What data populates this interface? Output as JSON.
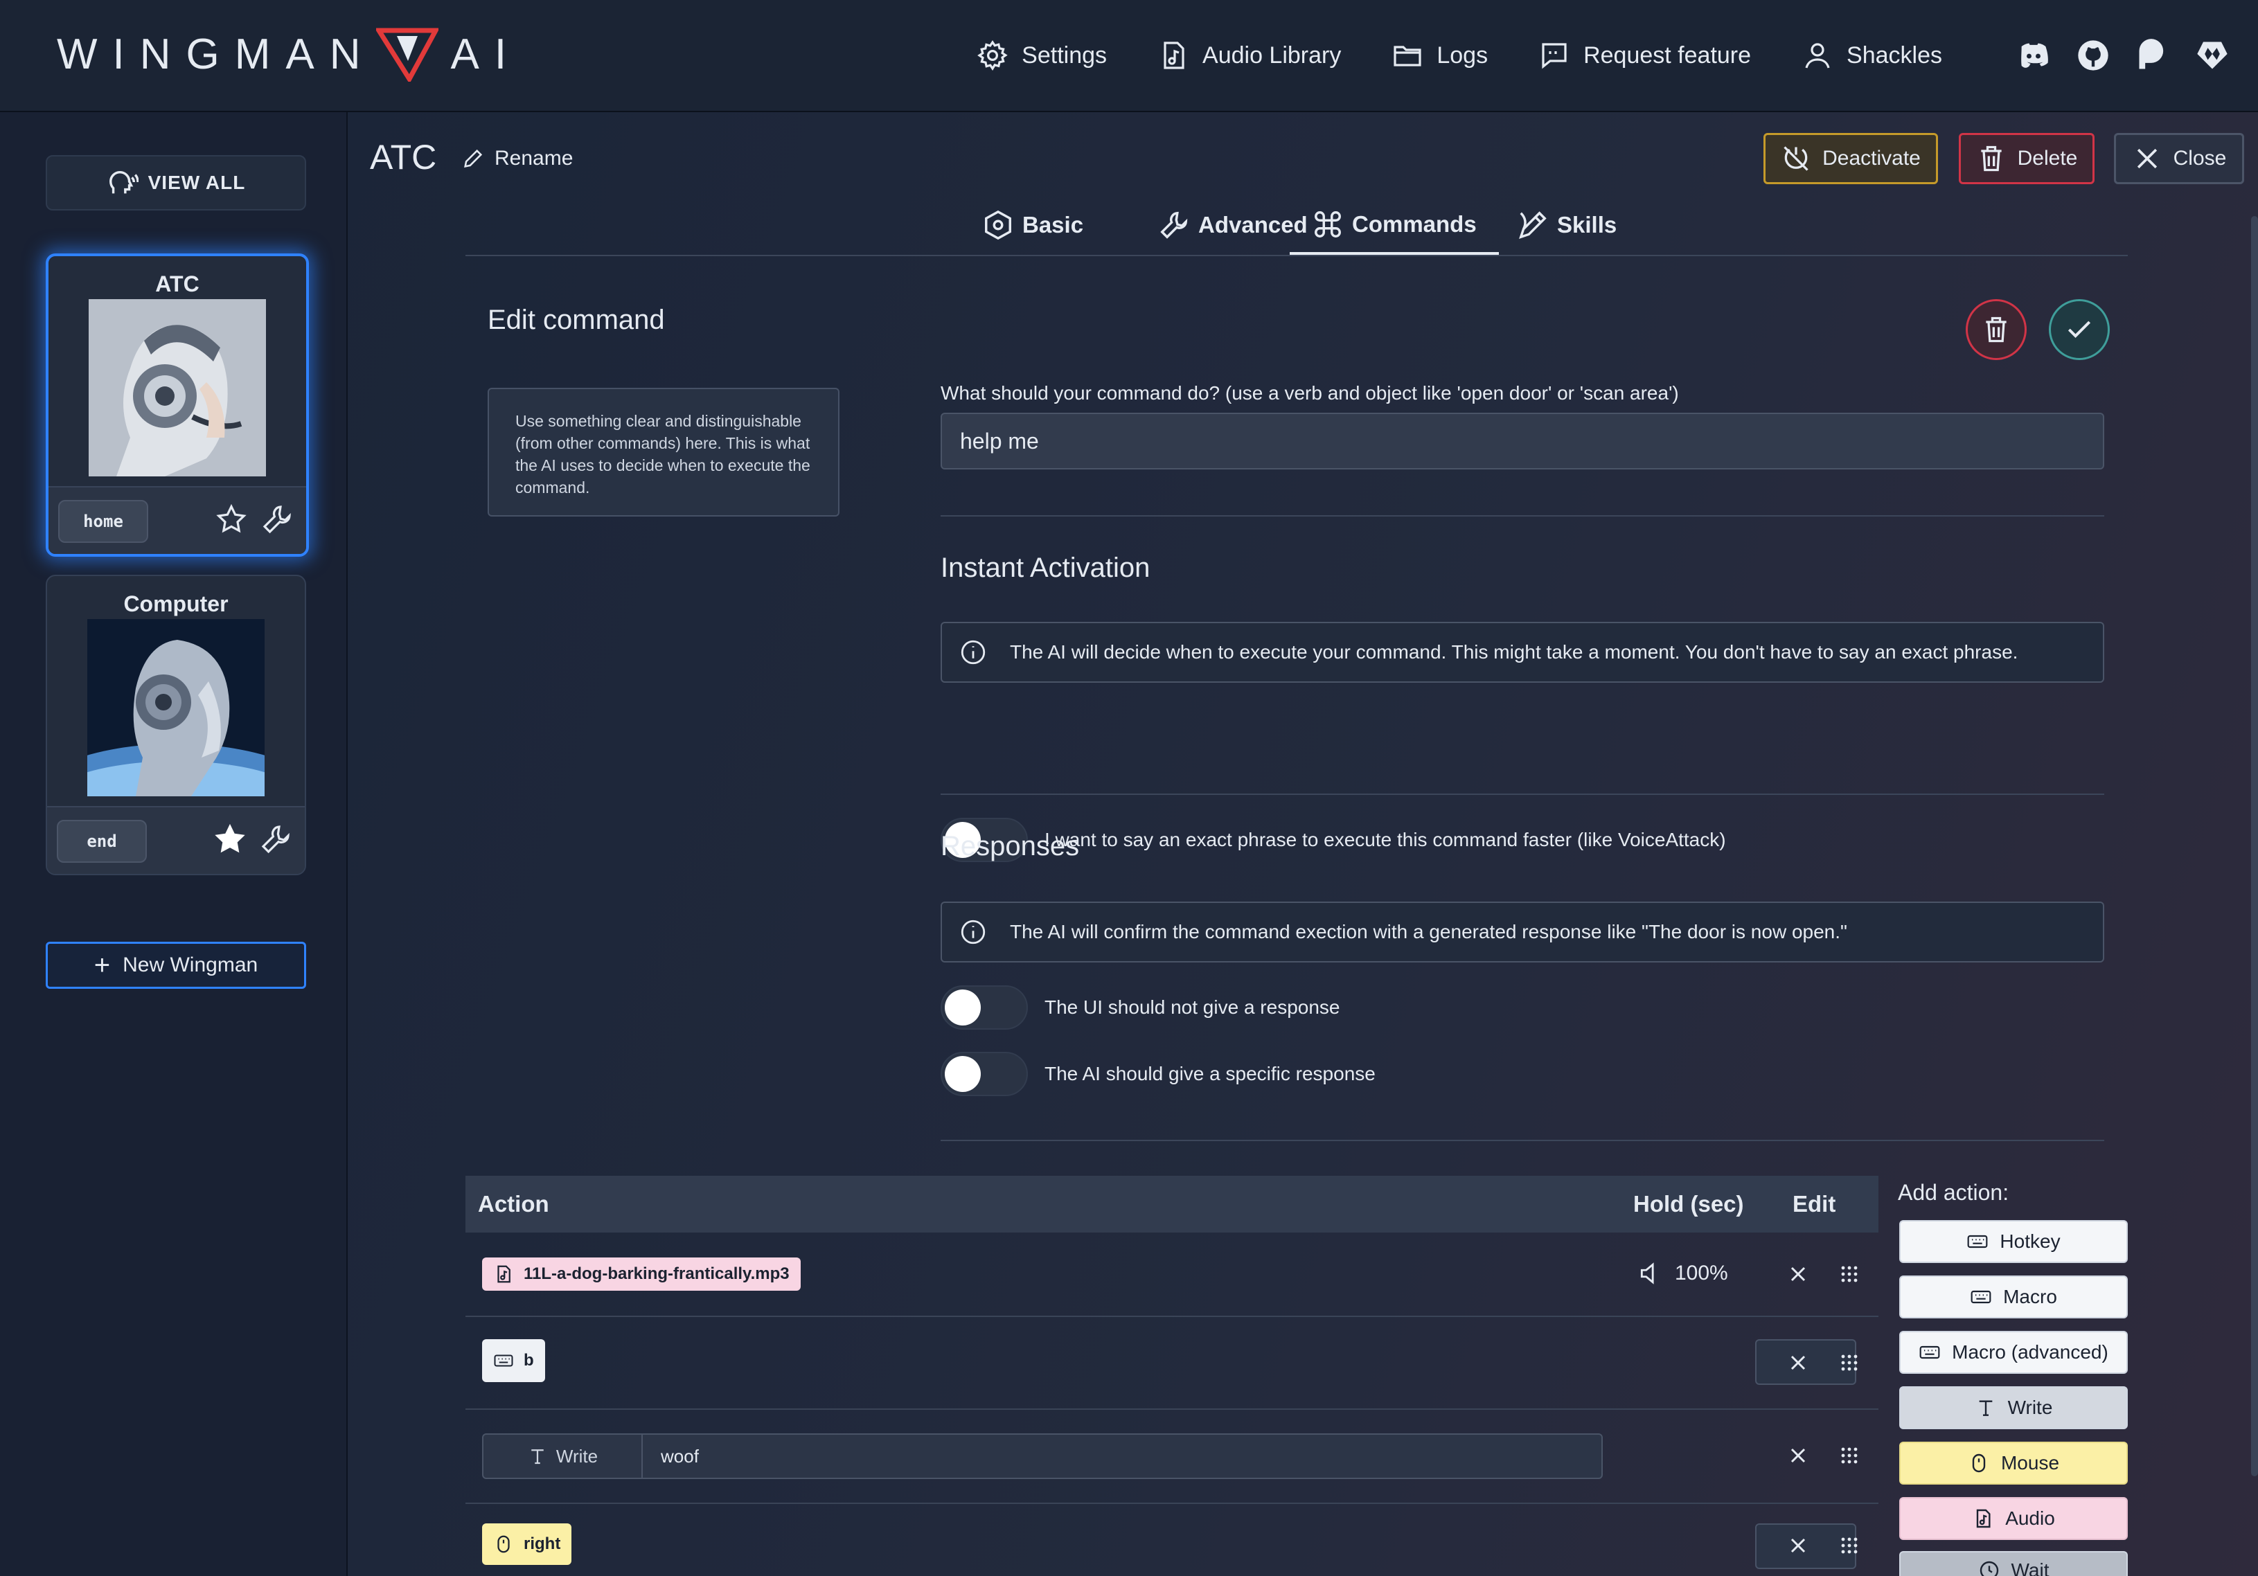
{
  "app": {
    "logo_text_left": "WINGMAN",
    "logo_text_right": "AI",
    "nav": [
      {
        "label": "Settings"
      },
      {
        "label": "Audio Library"
      },
      {
        "label": "Logs"
      },
      {
        "label": "Request feature"
      },
      {
        "label": "Shackles"
      }
    ]
  },
  "sidebar": {
    "view_all": "VIEW ALL",
    "wingmen": [
      {
        "name": "ATC",
        "hotkey": "home",
        "favorite": false,
        "active": true
      },
      {
        "name": "Computer",
        "hotkey": "end",
        "favorite": true,
        "active": false
      }
    ],
    "new_wingman": "New Wingman"
  },
  "header": {
    "title": "ATC",
    "rename": "Rename",
    "deactivate": "Deactivate",
    "delete": "Delete",
    "close": "Close"
  },
  "tabs": [
    {
      "label": "Basic"
    },
    {
      "label": "Advanced"
    },
    {
      "label": "Commands",
      "active": true
    },
    {
      "label": "Skills"
    }
  ],
  "edit": {
    "title": "Edit command",
    "hint": "Use something clear and distinguishable (from other commands) here. This is what the AI uses to decide when to execute the command.",
    "name_label": "What should your command do? (use a verb and object like 'open door' or 'scan area')",
    "name_value": "help me",
    "instant": {
      "title": "Instant Activation",
      "info": "The AI will decide when to execute your command. This might take a moment. You don't have to say an exact phrase.",
      "toggle": "I want to say an exact phrase to execute this command faster (like VoiceAttack)"
    },
    "responses": {
      "title": "Responses",
      "info": "The AI will confirm the command exection with a generated response like \"The door is now open.\"",
      "toggle1": "The UI should not give a response",
      "toggle2": "The AI should give a specific response"
    }
  },
  "actions": {
    "headers": {
      "action": "Action",
      "hold": "Hold (sec)",
      "edit": "Edit"
    },
    "rows": [
      {
        "type": "audio",
        "label": "11L-a-dog-barking-frantically.mp3",
        "volume": "100%"
      },
      {
        "type": "hotkey",
        "label": "b"
      },
      {
        "type": "write",
        "label": "Write",
        "value": "woof"
      },
      {
        "type": "mouse",
        "label": "right"
      }
    ],
    "add_title": "Add action:",
    "add_buttons": [
      "Hotkey",
      "Macro",
      "Macro (advanced)",
      "Write",
      "Mouse",
      "Audio",
      "Wait"
    ]
  },
  "colors": {
    "accent_blue": "#2f82ff",
    "danger": "#d13447",
    "warning": "#c59a2a",
    "success": "#3f9e9a",
    "logo_red": "#e23a3a"
  }
}
